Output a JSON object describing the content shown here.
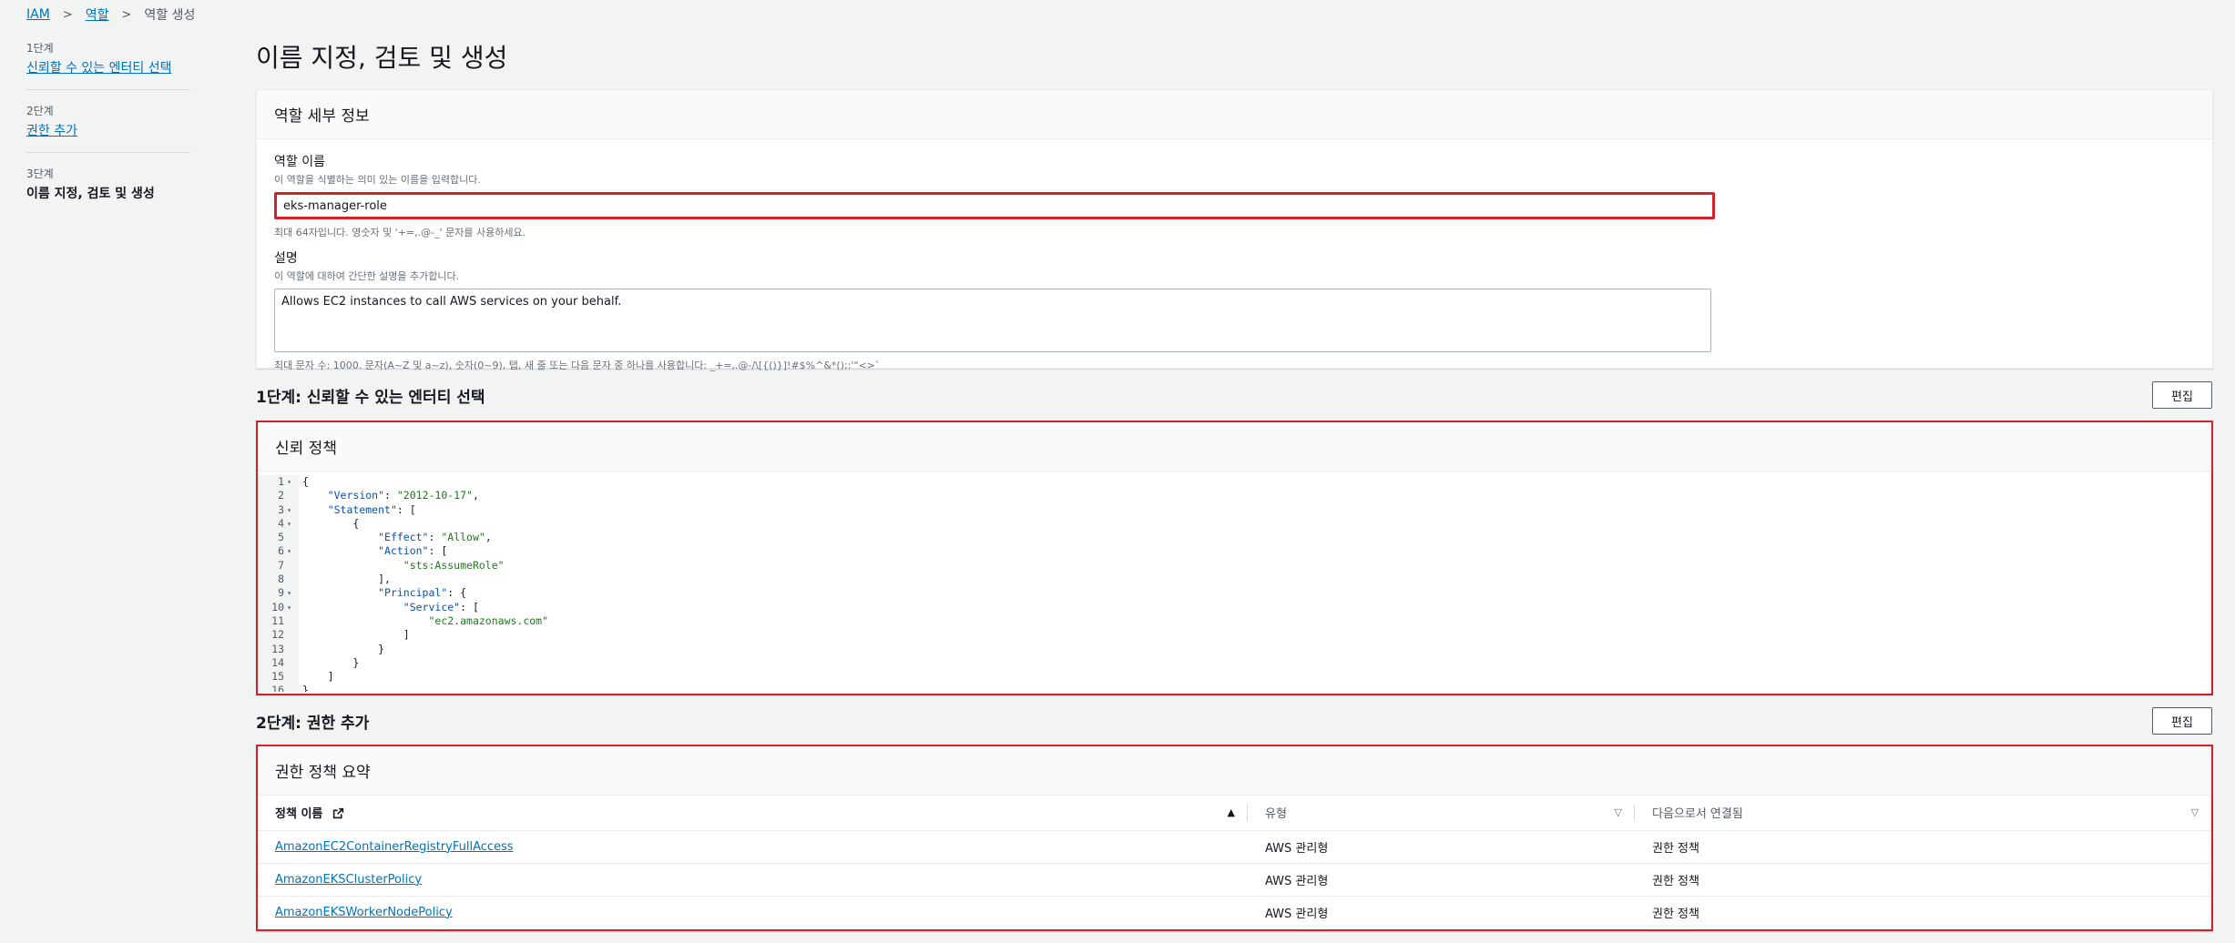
{
  "breadcrumb": {
    "items": [
      "IAM",
      "역할",
      "역할 생성"
    ]
  },
  "steps": [
    {
      "num": "1단계",
      "title": "신뢰할 수 있는 엔터티 선택"
    },
    {
      "num": "2단계",
      "title": "권한 추가"
    },
    {
      "num": "3단계",
      "title": "이름 지정, 검토 및 생성"
    }
  ],
  "page_title": "이름 지정, 검토 및 생성",
  "details": {
    "header": "역할 세부 정보",
    "name_label": "역할 이름",
    "name_desc": "이 역할을 식별하는 의미 있는 이름을 입력합니다.",
    "name_value": "eks-manager-role",
    "name_hint": "최대 64자입니다. 영숫자 및 '+=,.@-_' 문자를 사용하세요.",
    "desc_label": "설명",
    "desc_desc": "이 역할에 대하여 간단한 설명을 추가합니다.",
    "desc_value": "Allows EC2 instances to call AWS services on your behalf.",
    "desc_hint": "최대 문자 수: 1000. 문자(A~Z 및 a~z), 숫자(0~9), 탭, 새 줄 또는 다음 문자 중 하나를 사용합니다: _+=,.@-/\\[{()}]!#$%^&*();:'\"<>`"
  },
  "step1": {
    "title": "1단계: 신뢰할 수 있는 엔터티 선택",
    "edit_label": "편집"
  },
  "trust": {
    "header": "신뢰 정책",
    "lines": [
      "{",
      "    \"Version\": \"2012-10-17\",",
      "    \"Statement\": [",
      "        {",
      "            \"Effect\": \"Allow\",",
      "            \"Action\": [",
      "                \"sts:AssumeRole\"",
      "            ],",
      "            \"Principal\": {",
      "                \"Service\": [",
      "                    \"ec2.amazonaws.com\"",
      "                ]",
      "            }",
      "        }",
      "    ]",
      "}"
    ]
  },
  "step2": {
    "title": "2단계: 권한 추가",
    "edit_label": "편집"
  },
  "perms": {
    "header": "권한 정책 요약",
    "columns": [
      "정책 이름",
      "유형",
      "다음으로서 연결됨"
    ],
    "rows": [
      [
        "AmazonEC2ContainerRegistryFullAccess",
        "AWS 관리형",
        "권한 정책"
      ],
      [
        "AmazonEKSClusterPolicy",
        "AWS 관리형",
        "권한 정책"
      ],
      [
        "AmazonEKSWorkerNodePolicy",
        "AWS 관리형",
        "권한 정책"
      ]
    ]
  },
  "colors": {
    "accent": "#0073bb",
    "highlight": "#d0212b"
  }
}
